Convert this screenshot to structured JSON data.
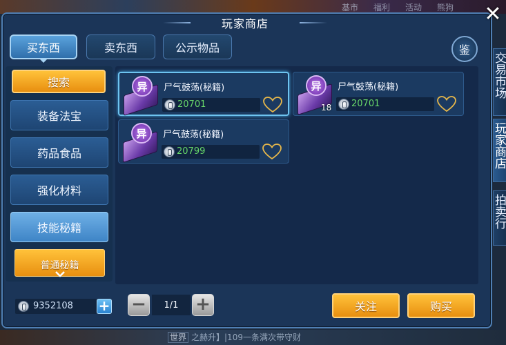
{
  "window": {
    "title": "玩家商店"
  },
  "background": {
    "top_labels": [
      "基市",
      "福利",
      "活动",
      "熊狗"
    ],
    "world_chat": {
      "channel": "世界",
      "text": "之赫升】|109一条满次带守财"
    }
  },
  "tabs": [
    {
      "label": "买东西",
      "active": true
    },
    {
      "label": "卖东西",
      "active": false
    },
    {
      "label": "公示物品",
      "active": false
    }
  ],
  "appraise_label": "鉴",
  "search_label": "搜索",
  "categories": [
    {
      "label": "装备法宝",
      "selected": false
    },
    {
      "label": "药品食品",
      "selected": false
    },
    {
      "label": "强化材料",
      "selected": false
    },
    {
      "label": "技能秘籍",
      "selected": true
    }
  ],
  "subcategory": {
    "label": "普通秘籍"
  },
  "items": [
    {
      "badge": "异",
      "name": "尸气鼓荡(秘籍)",
      "price": "20701",
      "quantity": "",
      "selected": true,
      "icon": "purple-book-icon"
    },
    {
      "badge": "异",
      "name": "尸气鼓荡(秘籍)",
      "price": "20701",
      "quantity": "18",
      "selected": false,
      "icon": "purple-book-icon"
    },
    {
      "badge": "异",
      "name": "尸气鼓荡(秘籍)",
      "price": "20799",
      "quantity": "",
      "selected": false,
      "icon": "purple-book-icon"
    }
  ],
  "currency": {
    "amount": "9352108",
    "add_label": "+"
  },
  "pagination": {
    "minus_label": "−",
    "page": "1/1",
    "plus_label": "+"
  },
  "actions": {
    "follow_label": "关注",
    "buy_label": "购买"
  },
  "side_tabs": [
    {
      "label": "交易市场",
      "active": false
    },
    {
      "label": "玩家商店",
      "active": true
    },
    {
      "label": "拍卖行",
      "active": false
    }
  ],
  "colors": {
    "price_green": "#68d86a",
    "accent_orange": "#f0a020",
    "tab_blue": "#3e84c6"
  }
}
